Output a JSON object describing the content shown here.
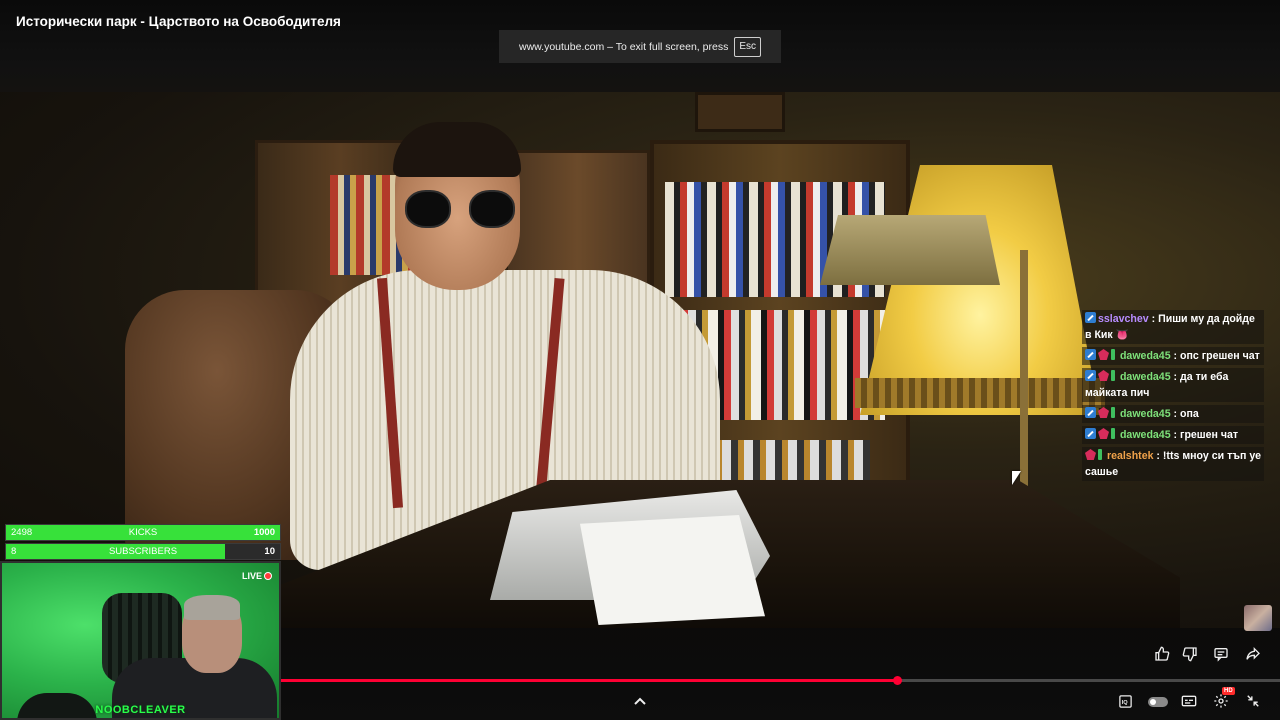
{
  "window": {
    "video_title": "Исторически парк - Царството на Освободителя",
    "fullscreen_notice": "www.youtube.com – To exit full screen, press",
    "fullscreen_key": "Esc"
  },
  "chat": {
    "messages": [
      {
        "user": "sslavchev",
        "text": "Пиши му да дойде в Кик 👅"
      },
      {
        "user": "daweda45",
        "text": "опс грешен чат"
      },
      {
        "user": "daweda45",
        "text": "да ти еба майката пич"
      },
      {
        "user": "daweda45",
        "text": "опа"
      },
      {
        "user": "daweda45",
        "text": "грешен чат"
      },
      {
        "user": "realshtek",
        "text": "!tts мноу си тъп уе сашье"
      }
    ]
  },
  "overlay": {
    "kicks_goal": {
      "current": "2498",
      "label": "KICKS",
      "max": "1000",
      "progress": 1.0
    },
    "subs_goal": {
      "current": "8",
      "label": "SUBSCRIBERS",
      "max": "10",
      "progress": 0.8
    },
    "live_label": "LIVE",
    "streamer_name": "NOOBCLEAVER"
  },
  "player": {
    "progress": 0.617,
    "controls": {
      "like": "like-icon",
      "dislike": "dislike-icon",
      "comments": "comment-icon",
      "share": "share-icon",
      "expand": "chevron-up-icon",
      "quality": "hd-icon",
      "autoplay": "autoplay-toggle",
      "subtitles": "subtitles-icon",
      "settings": "settings-icon",
      "exit_fullscreen": "exit-fullscreen-icon"
    },
    "quality_badge": "HD"
  },
  "colors": {
    "progress_red": "#ff0033",
    "goal_green": "#37e13a",
    "chat_user_purple": "#b78cff",
    "chat_user_green": "#7ee07a",
    "chat_user_orange": "#f0a24a"
  }
}
